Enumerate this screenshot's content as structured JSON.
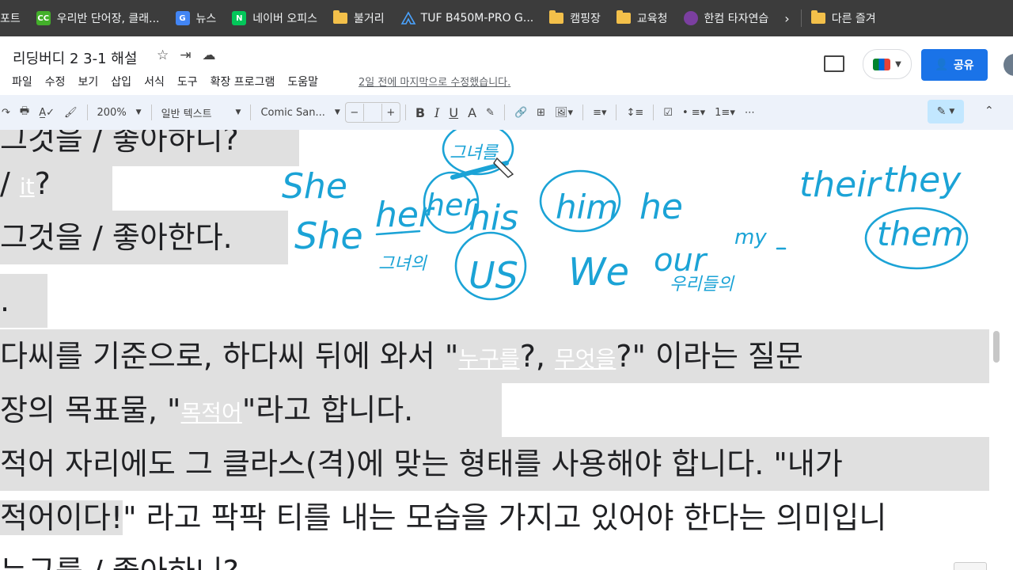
{
  "bookmarks": [
    {
      "label": "포트",
      "icon": "none"
    },
    {
      "label": "우리반 단어장, 클래...",
      "icon": "classcard-icon",
      "color": "#43b02a",
      "glyph": "CC"
    },
    {
      "label": "뉴스",
      "icon": "google-news-icon",
      "color": "#4285f4",
      "glyph": "G"
    },
    {
      "label": "네이버 오피스",
      "icon": "naver-icon",
      "color": "#03c75a",
      "glyph": "N"
    },
    {
      "label": "불거리",
      "icon": "folder-icon"
    },
    {
      "label": "TUF B450M-PRO G...",
      "icon": "asus-tuf-icon"
    },
    {
      "label": "캠핑장",
      "icon": "folder-icon"
    },
    {
      "label": "교육청",
      "icon": "folder-icon"
    },
    {
      "label": "한컴 타자연습",
      "icon": "hancom-icon",
      "color": "#7b3fa0"
    }
  ],
  "bookmarks_other": "다른 즐겨",
  "doc": {
    "title": "리딩버디 2 3-1 해설",
    "menu": [
      "파일",
      "수정",
      "보기",
      "삽입",
      "서식",
      "도구",
      "확장 프로그램",
      "도움말"
    ],
    "last_edit": "2일 전에 마지막으로 수정했습니다.",
    "share_label": "공유"
  },
  "toolbar": {
    "zoom": "200%",
    "style": "일반 텍스트",
    "font": "Comic San...",
    "minus": "−",
    "plus": "+",
    "bold": "B",
    "italic": "I",
    "underline": "U",
    "text_color": "A"
  },
  "body": {
    "line1": "그것을 / 좋아하니?",
    "line2_pre": "/ ",
    "line2_link": "it",
    "line2_post": "?",
    "line3": "그것을 / 좋아한다.",
    "line4": ".",
    "line5_pre": "다씨를 기준으로, 하다씨 뒤에 와서 \"",
    "line5_link1": "누구를",
    "line5_mid": "?, ",
    "line5_link2": "무엇을",
    "line5_post": "?\" 이라는 질문",
    "line6_pre": "장의 목표물, \"",
    "line6_link": "목적어",
    "line6_post": "\"라고 합니다.",
    "line7": "적어 자리에도 그 클라스(격)에 맞는 형태를 사용해야 합니다. \"내가",
    "line8_hl": "적어이다!",
    "line8_post": "\" 라고 팍팍 티를 내는 모습을 가지고 있어야 한다는 의미입니",
    "line9": "누구를 / 좋아하니?"
  },
  "handwriting": {
    "she1": "She",
    "she2": "She",
    "her1": "her",
    "her2": "her",
    "her_gloss": "그녀의",
    "top_gloss": "그녀를",
    "his": "his",
    "him": "him",
    "he": "he",
    "us": "US",
    "we": "We",
    "our": "our",
    "our_gloss": "우리들의",
    "my": "my",
    "their": "their",
    "they": "they",
    "them": "them"
  },
  "colors": {
    "ink": "#1ba3d6",
    "accent": "#1a73e8",
    "highlight": "#e0e0e0"
  }
}
